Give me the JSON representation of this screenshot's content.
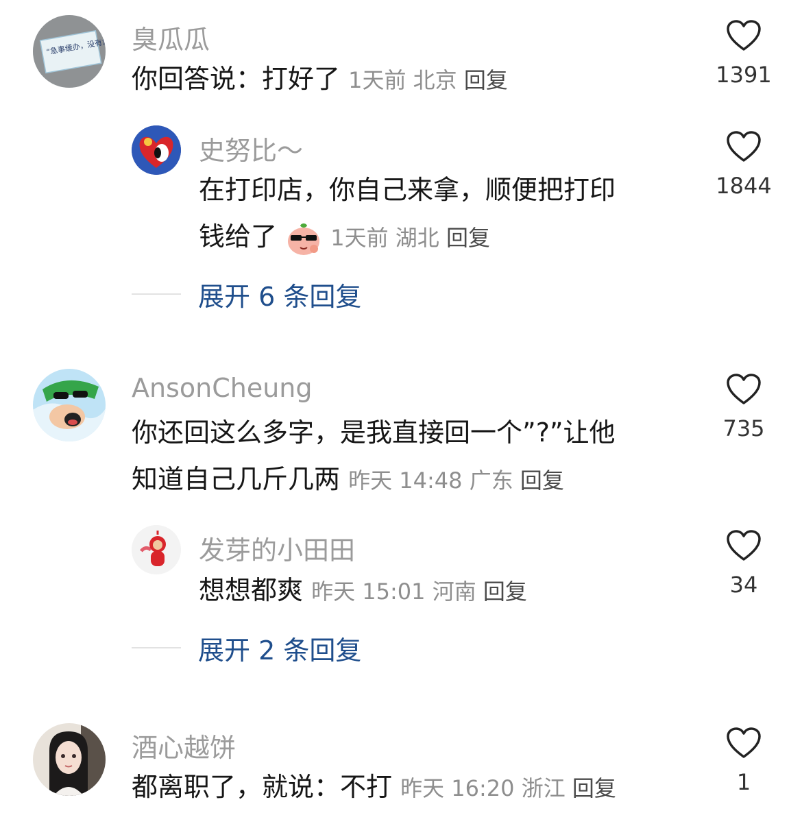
{
  "comments": [
    {
      "username": "臭瓜瓜",
      "avatar_text": "“急事缓办，没有急事。”",
      "text": "你回答说：打好了",
      "time": "1天前",
      "location": "北京",
      "reply": "回复",
      "likes": "1391",
      "replies": [
        {
          "username": "史努比～",
          "text_line1": "在打印店，你自己来拿，顺便把打印",
          "text_line2": "钱给了",
          "time": "1天前",
          "location": "湖北",
          "reply": "回复",
          "likes": "1844"
        }
      ],
      "expand_label": "展开 6 条回复"
    },
    {
      "username": "AnsonCheung",
      "text_line1": "你还回这么多字，是我直接回一个”?”让他",
      "text_line2": "知道自己几斤几两",
      "time": "昨天 14:48",
      "location": "广东",
      "reply": "回复",
      "likes": "735",
      "replies": [
        {
          "username": "发芽的小田田",
          "text": "想想都爽",
          "time": "昨天 15:01",
          "location": "河南",
          "reply": "回复",
          "likes": "34"
        }
      ],
      "expand_label": "展开 2 条回复"
    },
    {
      "username": "酒心越饼",
      "text": "都离职了，就说：不打",
      "time": "昨天 16:20",
      "location": "浙江",
      "reply": "回复",
      "likes": "1"
    }
  ]
}
